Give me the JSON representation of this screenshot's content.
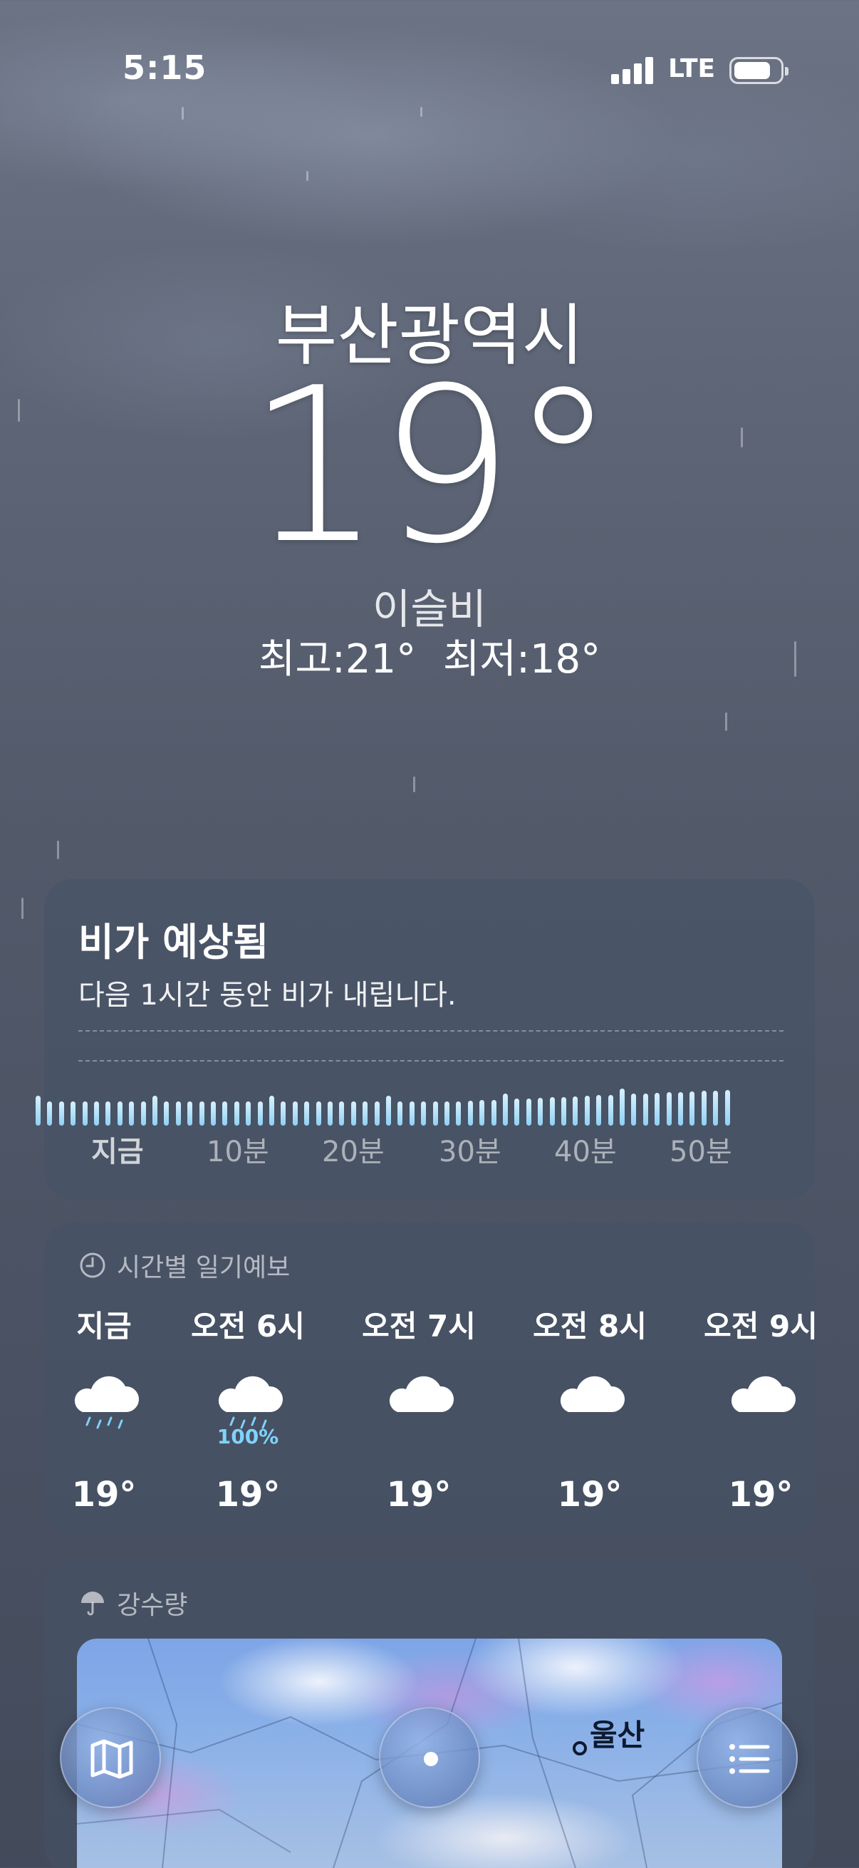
{
  "status_bar": {
    "time": "5:15",
    "network": "LTE"
  },
  "location": {
    "city": "부산광역시",
    "temperature": "19°",
    "condition": "이슬비",
    "high": "최고:21°",
    "low": "최저:18°"
  },
  "rain_card": {
    "title": "비가 예상됨",
    "subtitle": "다음 1시간 동안 비가 내립니다.",
    "axis_labels": [
      "지금",
      "10분",
      "20분",
      "30분",
      "40분",
      "50분"
    ]
  },
  "hourly": {
    "section_title": "시간별 일기예보",
    "items": [
      {
        "label": "지금",
        "icon": "cloud-drizzle-icon",
        "pop": "",
        "temp": "19°"
      },
      {
        "label": "오전 6시",
        "icon": "cloud-rain-icon",
        "pop": "100%",
        "temp": "19°"
      },
      {
        "label": "오전 7시",
        "icon": "cloud-icon",
        "pop": "",
        "temp": "19°"
      },
      {
        "label": "오전 8시",
        "icon": "cloud-icon",
        "pop": "",
        "temp": "19°"
      },
      {
        "label": "오전 9시",
        "icon": "cloud-icon",
        "pop": "",
        "temp": "19°"
      }
    ]
  },
  "precipitation": {
    "section_title": "강수량",
    "map_label": "울산"
  },
  "colors": {
    "rain_bar": "#a7dcf8",
    "pop_text": "#7fd3ff",
    "map_label": "#0e1a30"
  }
}
